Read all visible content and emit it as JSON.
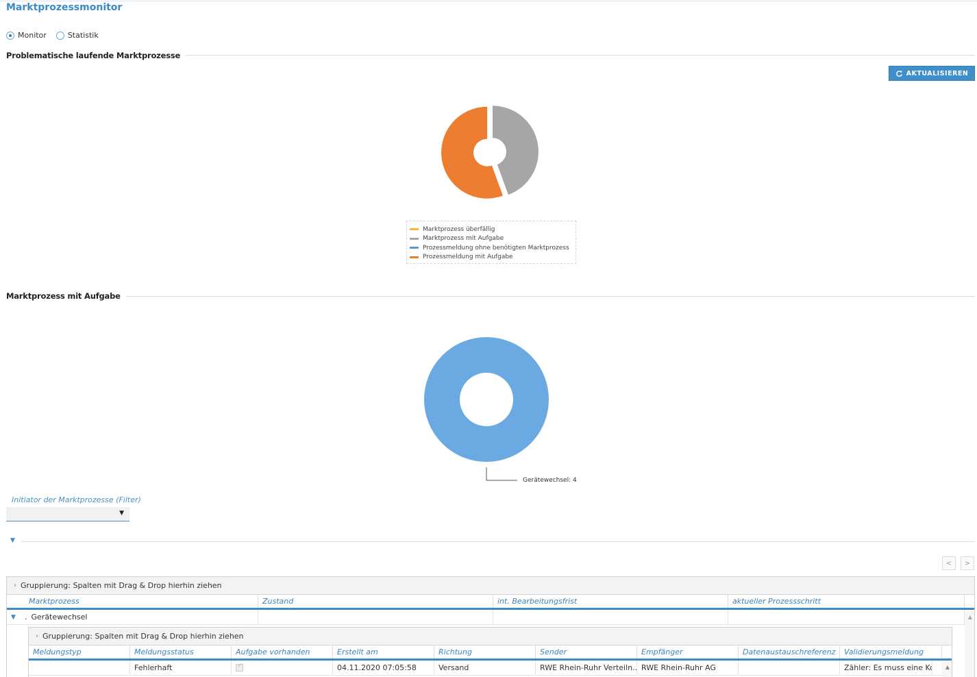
{
  "app": {
    "title": "Marktprozessmonitor"
  },
  "view_switch": {
    "options": [
      {
        "label": "Monitor",
        "checked": true
      },
      {
        "label": "Statistik",
        "checked": false
      }
    ]
  },
  "section1": {
    "title": "Problematische laufende Marktprozesse"
  },
  "refresh_button": {
    "label": "AKTUALISIEREN",
    "icon": "refresh-icon"
  },
  "chart1": {
    "type": "pie",
    "legend": [
      {
        "label": "Marktprozess überfällig",
        "color": "#f5b82e"
      },
      {
        "label": "Marktprozess mit Aufgabe",
        "color": "#a6a6a6"
      },
      {
        "label": "Prozessmeldung ohne benötigten Marktprozess",
        "color": "#5b9bd5"
      },
      {
        "label": "Prozessmeldung mit Aufgabe",
        "color": "#ed7d31"
      }
    ]
  },
  "chart_data": [
    {
      "type": "pie",
      "title": "",
      "labels": [
        "Marktprozess überfällig",
        "Marktprozess mit Aufgabe",
        "Prozessmeldung ohne benötigten Marktprozess",
        "Prozessmeldung mit Aufgabe"
      ],
      "values": [
        0,
        4,
        0,
        5
      ],
      "colors": [
        "#f5b82e",
        "#a6a6a6",
        "#5b9bd5",
        "#ed7d31"
      ],
      "legend": "bottom"
    },
    {
      "type": "pie",
      "title": "",
      "labels": [
        "Gerätewechsel"
      ],
      "values": [
        4
      ],
      "colors": [
        "#6aa9e1"
      ],
      "data_labels": [
        "Gerätewechsel: 4"
      ]
    }
  ],
  "section2": {
    "title": "Marktprozess mit Aufgabe"
  },
  "chart2": {
    "label": "Gerätewechsel: 4"
  },
  "filter": {
    "label": "Initiator der Marktprozesse (Filter)",
    "value": ""
  },
  "pager": {
    "prev": "<",
    "next": ">"
  },
  "grid": {
    "group_hint": "Gruppierung: Spalten mit Drag & Drop hierhin ziehen",
    "columns": [
      "Marktprozess",
      "Zustand",
      "int. Bearbeitungsfrist",
      "aktueller Prozessschritt"
    ],
    "rows": [
      {
        "expander": "▼",
        "marker": ".",
        "name": "Gerätewechsel",
        "zustand": "",
        "frist": "",
        "schritt": ""
      }
    ],
    "sub": {
      "group_hint": "Gruppierung: Spalten mit Drag & Drop hierhin ziehen",
      "columns": [
        "Meldungstyp",
        "Meldungsstatus",
        "Aufgabe vorhanden",
        "Erstellt am",
        "Richtung",
        "Sender",
        "Empfänger",
        "Datenaustauschreferenz",
        "Validierungsmeldung"
      ],
      "rows": [
        {
          "meldungstyp": "",
          "status": "Fehlerhaft",
          "aufgabe": true,
          "erstellt": "04.11.2020 07:05:58",
          "richtung": "Versand",
          "sender": "RWE Rhein-Ruhr Verteiln...",
          "empfaenger": "RWE Rhein-Ruhr AG",
          "referenz": "",
          "validierung": "Zähler: Es muss eine Ko..."
        }
      ]
    }
  }
}
